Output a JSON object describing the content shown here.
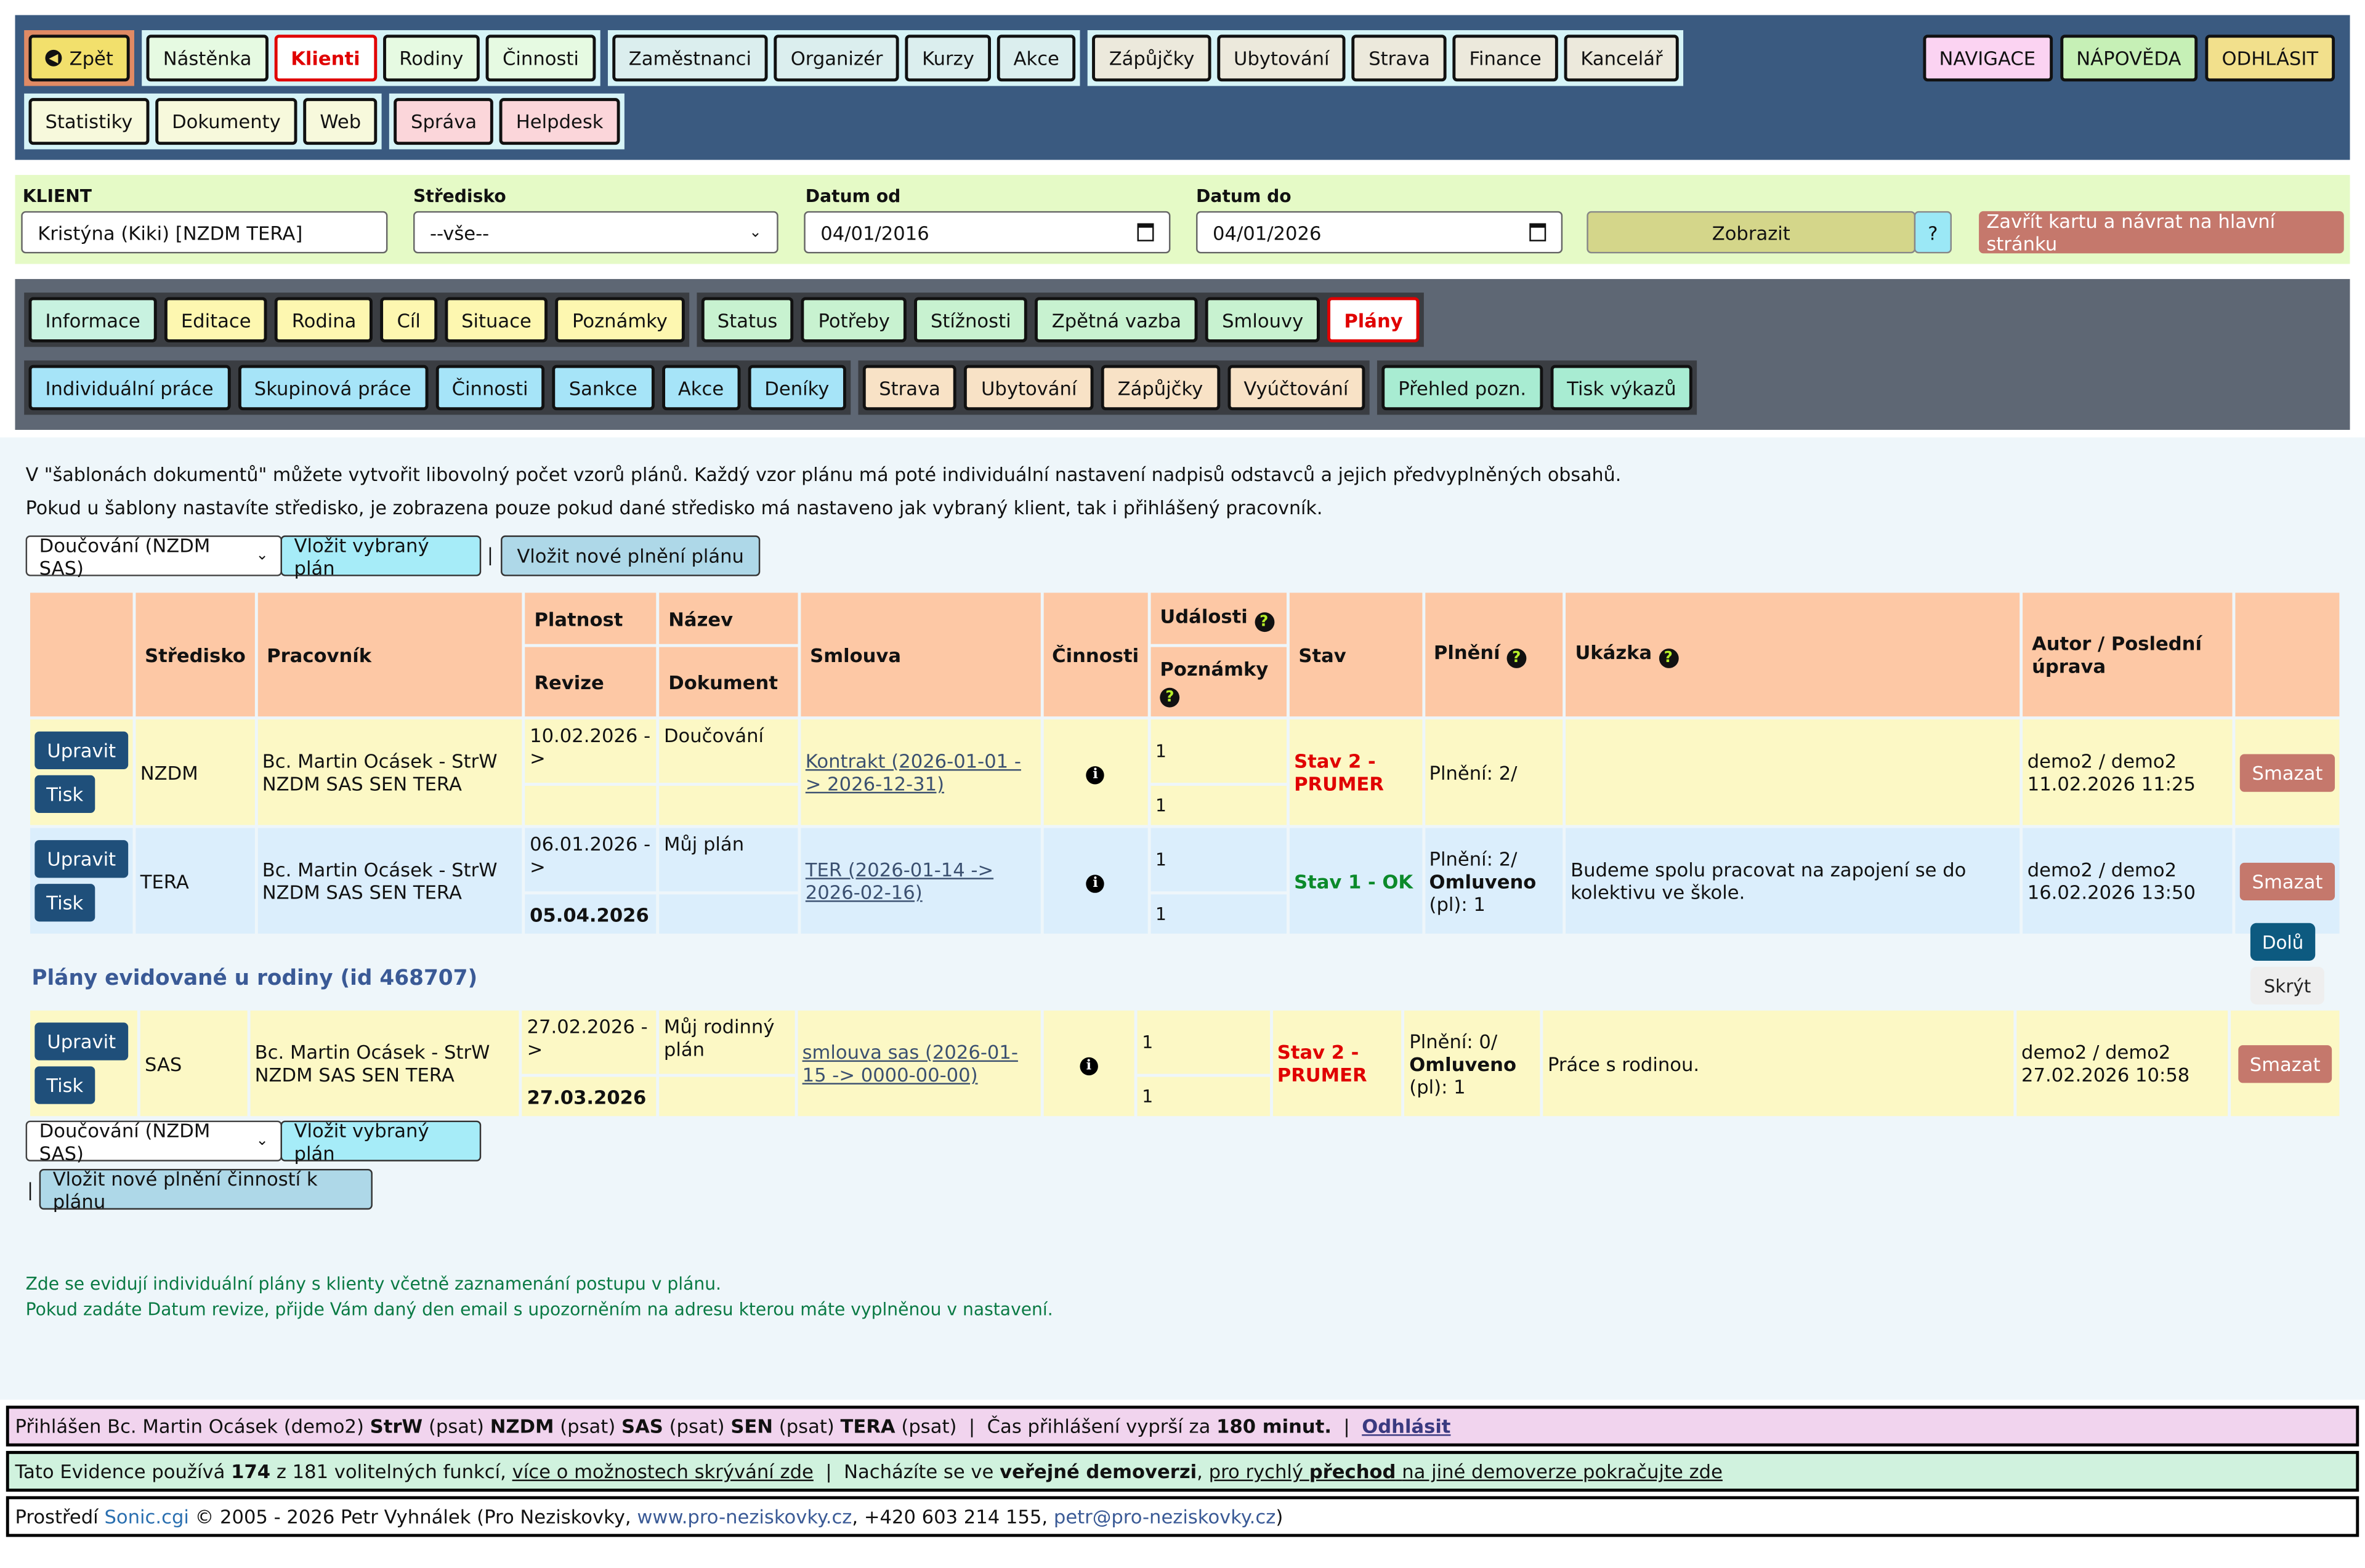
{
  "nav": {
    "back": "Zpět",
    "group1": [
      "Nástěnka",
      "Klienti",
      "Rodiny",
      "Činnosti"
    ],
    "group2": [
      "Zaměstnanci",
      "Organizér",
      "Kurzy",
      "Akce"
    ],
    "group3": [
      "Zápůjčky",
      "Ubytování",
      "Strava",
      "Finance",
      "Kancelář"
    ],
    "group4": [
      "Statistiky",
      "Dokumenty",
      "Web"
    ],
    "group5": [
      "Správa",
      "Helpdesk"
    ],
    "right": [
      "NAVIGACE",
      "NÁPOVĚDA",
      "ODHLÁSIT"
    ]
  },
  "filter": {
    "client_label": "KLIENT",
    "client_value": "Kristýna (Kiki) [NZDM TERA]",
    "center_label": "Středisko",
    "center_value": "--vše--",
    "from_label": "Datum od",
    "from_value": "04/01/2016",
    "to_label": "Datum do",
    "to_value": "04/01/2026",
    "show_button": "Zobrazit",
    "help_button": "?",
    "close_button": "Zavřít kartu a návrat na hlavní stránku"
  },
  "tabs": {
    "row1_g1": [
      "Informace",
      "Editace",
      "Rodina",
      "Cíl",
      "Situace",
      "Poznámky"
    ],
    "row1_g2": [
      "Status",
      "Potřeby",
      "Stížnosti",
      "Zpětná vazba",
      "Smlouvy",
      "Plány"
    ],
    "row2_g1": [
      "Individuální práce",
      "Skupinová práce",
      "Činnosti",
      "Sankce",
      "Akce",
      "Deníky"
    ],
    "row2_g2": [
      "Strava",
      "Ubytování",
      "Zápůjčky",
      "Vyúčtování"
    ],
    "row2_g3": [
      "Přehled pozn.",
      "Tisk výkazů"
    ]
  },
  "content": {
    "info1": "V \"šablonách dokumentů\" můžete vytvořit libovolný počet vzorů plánů. Každý vzor plánu má poté individuální nastavení nadpisů odstavců a jejich předvyplněných obsahů.",
    "info2": "Pokud u šablony nastavíte středisko, je zobrazena pouze pokud dané středisko má nastaveno jak vybraný klient, tak i přihlášený pracovník.",
    "template_select": "Doučování (NZDM SAS)",
    "insert_selected": "Vložit vybraný plán",
    "separator": "|",
    "insert_new": "Vložit nové plnění plánu",
    "insert_new_activity": "Vložit nové plnění činností k plánu",
    "family_heading": "Plány evidované u rodiny (id 468707)",
    "down_button": "Dolů",
    "hide_button": "Skrýt",
    "note1": "Zde se evidují individuální plány s klienty včetně zaznamenání postupu v plánu.",
    "note2": "Pokud zadáte Datum revize, přijde Vám daný den email s upozorněním na adresu kterou máte vyplněnou v nastavení."
  },
  "table": {
    "headers": {
      "center": "Středisko",
      "worker": "Pracovník",
      "validity": "Platnost",
      "revision": "Revize",
      "name": "Název",
      "document": "Dokument",
      "contract": "Smlouva",
      "activities": "Činnosti",
      "events": "Události",
      "notes": "Poznámky",
      "state": "Stav",
      "fulfil": "Plnění",
      "preview": "Ukázka",
      "author": "Autor / Poslední úprava"
    },
    "edit": "Upravit",
    "print": "Tisk",
    "delete": "Smazat",
    "rows": [
      {
        "center": "NZDM",
        "worker": "Bc. Martin Ocásek - StrW NZDM SAS SEN TERA",
        "validity": "10.02.2026 ->",
        "revision": "",
        "name": "Doučování",
        "contract": "Kontrakt (2026-01-01 -> 2026-12-31)",
        "events": "1",
        "notes": "1",
        "state": "Stav 2 - PRUMER",
        "fulfil": "Plnění: 2/",
        "omluveno": "",
        "omluveno_val": "",
        "preview": "",
        "author": "demo2 / demo2",
        "author_date": "11.02.2026 11:25"
      },
      {
        "center": "TERA",
        "worker": "Bc. Martin Ocásek - StrW NZDM SAS SEN TERA",
        "validity": "06.01.2026 ->",
        "revision": "05.04.2026",
        "name": "Můj plán",
        "contract": "TER (2026-01-14 -> 2026-02-16)",
        "events": "1",
        "notes": "1",
        "state": "Stav 1 - OK",
        "fulfil": "Plnění: 2/",
        "omluveno": "Omluveno",
        "omluveno_val": "(pl): 1",
        "preview": "Budeme spolu pracovat na zapojení se do kolektivu ve škole.",
        "author": "demo2 / demo2",
        "author_date": "16.02.2026 13:50"
      }
    ],
    "family_rows": [
      {
        "center": "SAS",
        "worker": "Bc. Martin Ocásek - StrW NZDM SAS SEN TERA",
        "validity": "27.02.2026 ->",
        "revision": "27.03.2026",
        "name": "Můj rodinný plán",
        "contract": "smlouva sas (2026-01-15 -> 0000-00-00)",
        "events": "1",
        "notes": "1",
        "state": "Stav 2 - PRUMER",
        "fulfil": "Plnění: 0/",
        "omluveno": "Omluveno",
        "omluveno_val": "(pl): 1",
        "preview": "Práce s rodinou.",
        "author": "demo2 / demo2",
        "author_date": "27.02.2026 10:58"
      }
    ]
  },
  "footer": {
    "login_prefix": "Přihlášen Bc. Martin Ocásek (demo2)",
    "roles": [
      [
        "StrW",
        "(psat)"
      ],
      [
        "NZDM",
        "(psat)"
      ],
      [
        "SAS",
        "(psat)"
      ],
      [
        "SEN",
        "(psat)"
      ],
      [
        "TERA",
        "(psat)"
      ]
    ],
    "expire_text": "Čas přihlášení vyprší za",
    "expire_value": "180 minut.",
    "logout": "Odhlásit",
    "usage_prefix": "Tato Evidence používá",
    "usage_count": "174",
    "usage_suffix": "z 181 volitelných funkcí,",
    "usage_link": "více o možnostech skrývání zde",
    "demo_prefix": "Nacházíte se ve",
    "demo_bold": "veřejné demoverzi",
    "demo_link_a": "pro rychlý",
    "demo_link_b": "přechod",
    "demo_link_c": "na jiné demoverze pokračujte zde",
    "env_prefix": "Prostředí",
    "env_name": "Sonic.cgi",
    "env_copy": "© 2005 - 2026 Petr Vyhnálek (Pro Neziskovky,",
    "env_web": "www.pro-neziskovky.cz",
    "env_phone": ", +420 603 214 155,",
    "env_mail": "petr@pro-neziskovky.cz",
    "env_end": ")"
  },
  "colors": {
    "top_bar": "#3a5a80",
    "filter_bar": "#e5fac6",
    "tabs_bar": "#5e6774",
    "header_cell": "#fdc8a5",
    "row_yellow": "#fcf8c5",
    "row_blue": "#dbeefc",
    "edit_button": "#1f4f7a",
    "delete_button": "#c5786c",
    "active_red": "#e00000"
  }
}
